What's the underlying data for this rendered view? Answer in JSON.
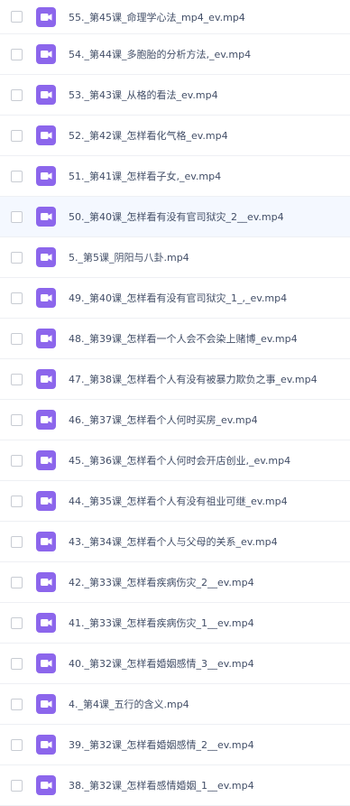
{
  "theme": {
    "icon_color": "#8c66ec"
  },
  "files": [
    {
      "name": "55._第45课_命理学心法_mp4_ev.mp4",
      "icon": "video-file-icon",
      "selected": false
    },
    {
      "name": "54._第44课_多胞胎的分析方法,_ev.mp4",
      "icon": "video-file-icon",
      "selected": false
    },
    {
      "name": "53._第43课_从格的看法_ev.mp4",
      "icon": "video-file-icon",
      "selected": false
    },
    {
      "name": "52._第42课_怎样看化气格_ev.mp4",
      "icon": "video-file-icon",
      "selected": false
    },
    {
      "name": "51._第41课_怎样看子女,_ev.mp4",
      "icon": "video-file-icon",
      "selected": false
    },
    {
      "name": "50._第40课_怎样看有没有官司狱灾_2__ev.mp4",
      "icon": "video-file-icon",
      "selected": true
    },
    {
      "name": "5._第5课_阴阳与八卦.mp4",
      "icon": "video-file-icon",
      "selected": false
    },
    {
      "name": "49._第40课_怎样看有没有官司狱灾_1_,_ev.mp4",
      "icon": "video-file-icon",
      "selected": false
    },
    {
      "name": "48._第39课_怎样看一个人会不会染上赌博_ev.mp4",
      "icon": "video-file-icon",
      "selected": false
    },
    {
      "name": "47._第38课_怎样看个人有没有被暴力欺负之事_ev.mp4",
      "icon": "video-file-icon",
      "selected": false
    },
    {
      "name": "46._第37课_怎样看个人何时买房_ev.mp4",
      "icon": "video-file-icon",
      "selected": false
    },
    {
      "name": "45._第36课_怎样看个人何时会开店创业,_ev.mp4",
      "icon": "video-file-icon",
      "selected": false
    },
    {
      "name": "44._第35课_怎样看个人有没有祖业可继_ev.mp4",
      "icon": "video-file-icon",
      "selected": false
    },
    {
      "name": "43._第34课_怎样看个人与父母的关系_ev.mp4",
      "icon": "video-file-icon",
      "selected": false
    },
    {
      "name": "42._第33课_怎样看疾病伤灾_2__ev.mp4",
      "icon": "video-file-icon",
      "selected": false
    },
    {
      "name": "41._第33课_怎样看疾病伤灾_1__ev.mp4",
      "icon": "video-file-icon",
      "selected": false
    },
    {
      "name": "40._第32课_怎样看婚姻感情_3__ev.mp4",
      "icon": "video-file-icon",
      "selected": false
    },
    {
      "name": "4._第4课_五行的含义.mp4",
      "icon": "video-file-icon",
      "selected": false
    },
    {
      "name": "39._第32课_怎样看婚姻感情_2__ev.mp4",
      "icon": "video-file-icon",
      "selected": false
    },
    {
      "name": "38._第32课_怎样看感情婚姻_1__ev.mp4",
      "icon": "video-file-icon",
      "selected": false
    }
  ]
}
